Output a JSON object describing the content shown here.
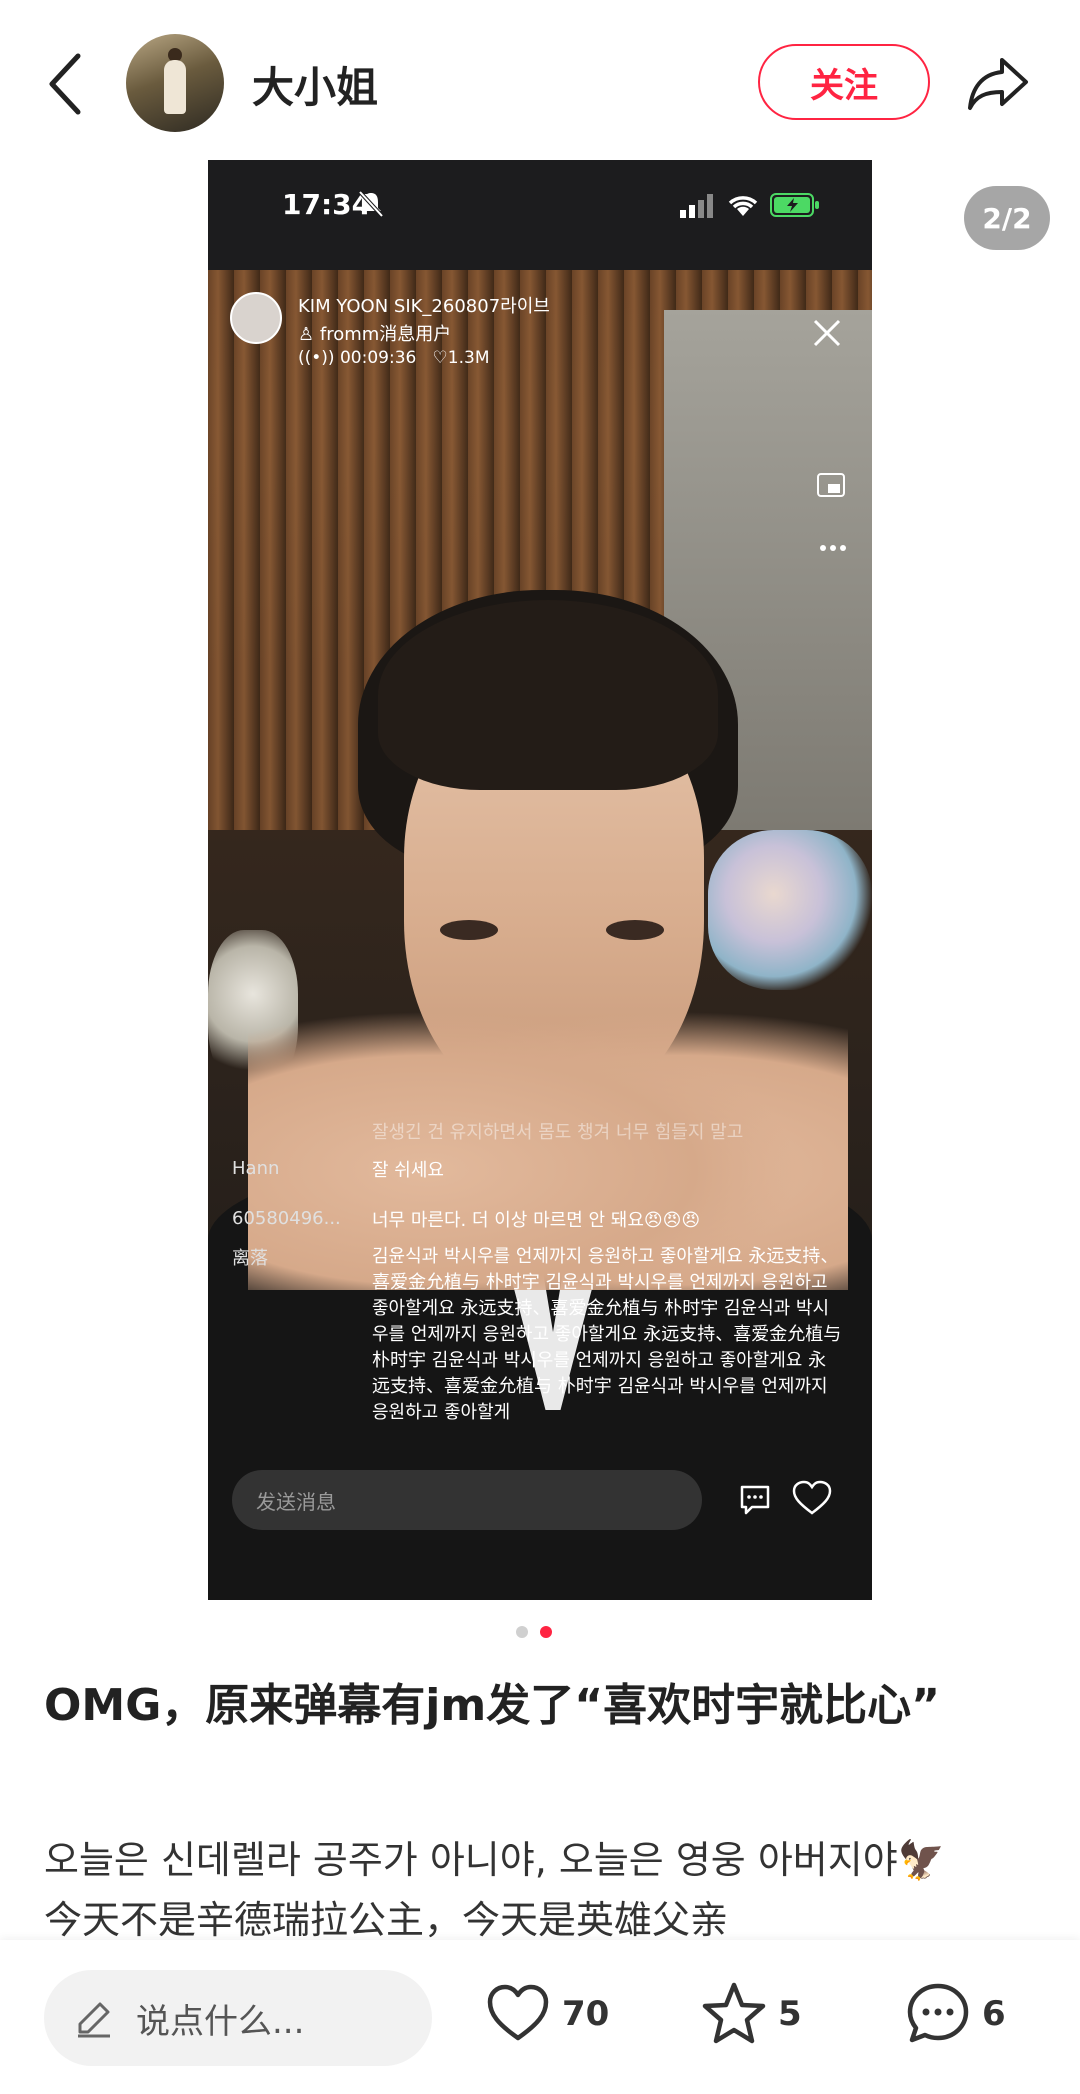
{
  "header": {
    "username": "大小姐",
    "follow_label": "关注"
  },
  "gallery": {
    "page_indicator": "2/2",
    "current_index": 2,
    "total": 2
  },
  "screenshot": {
    "status_time": "17:34",
    "live_title": "KIM YOON SIK_260807라이브",
    "host_label": "fromm消息用户",
    "duration": "00:09:36",
    "likes": "1.3M",
    "message_placeholder": "发送消息",
    "comments": [
      {
        "user": "",
        "text": "잘생긴 건 유지하면서 몸도 챙겨 너무 힘들지 말고",
        "faded": true
      },
      {
        "user": "Hann",
        "text": "잘 쉬세요",
        "faded": false
      },
      {
        "user": "60580496...",
        "text": "너무 마른다. 더 이상 마르면 안 돼요😠😠😠",
        "faded": false
      },
      {
        "user": "离落",
        "text": "김윤식과 박시우를 언제까지 응원하고 좋아할게요 永远支持、喜爱金允植与 朴时宇 김윤식과 박시우를 언제까지 응원하고 좋아할게요 永远支持、喜爱金允植与 朴时宇 김윤식과 박시우를 언제까지 응원하고 좋아할게요 永远支持、喜爱金允植与 朴时宇 김윤식과 박시우를 언제까지 응원하고 좋아할게요 永远支持、喜爱金允植与 朴时宇 김윤식과 박시우를 언제까지 응원하고 좋아할게",
        "faded": false
      }
    ]
  },
  "post": {
    "title": "OMG，原来弹幕有jm发了“喜欢时宇就比心”",
    "body_line1": "오늘은 신데렐라 공주가 아니야, 오늘은 영웅 아버지야🦅",
    "body_line2": "今天不是辛德瑞拉公主，今天是英雄父亲"
  },
  "footer": {
    "comment_placeholder": "说点什么...",
    "likes": "70",
    "stars": "5",
    "comments": "6"
  },
  "colors": {
    "accent": "#ff2442",
    "dot_inactive": "#d0d0d0"
  }
}
